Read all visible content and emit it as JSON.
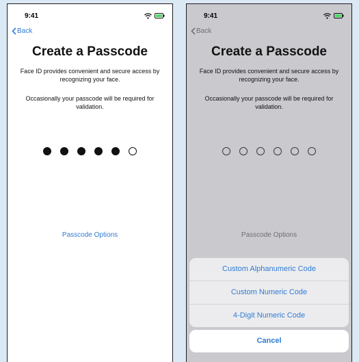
{
  "colors": {
    "accent": "#2f7bd4",
    "battery": "#4cd964",
    "dimmed_bg": "#c9c9ce",
    "page_bg": "#dbe9f5"
  },
  "left": {
    "status_time": "9:41",
    "back_label": "Back",
    "title": "Create a Passcode",
    "desc1": "Face ID provides convenient and secure access by recognizing your face.",
    "desc2": "Occasionally your passcode will be required for validation.",
    "passcode": {
      "length": 6,
      "filled": 5
    },
    "options_label": "Passcode Options"
  },
  "right": {
    "status_time": "9:41",
    "back_label": "Back",
    "title": "Create a Passcode",
    "desc1": "Face ID provides convenient and secure access by recognizing your face.",
    "desc2": "Occasionally your passcode will be required for validation.",
    "passcode": {
      "length": 6,
      "filled": 0
    },
    "options_label": "Passcode Options",
    "action_sheet": {
      "items": [
        "Custom Alphanumeric Code",
        "Custom Numeric Code",
        "4-Digit Numeric Code"
      ],
      "cancel_label": "Cancel"
    }
  }
}
